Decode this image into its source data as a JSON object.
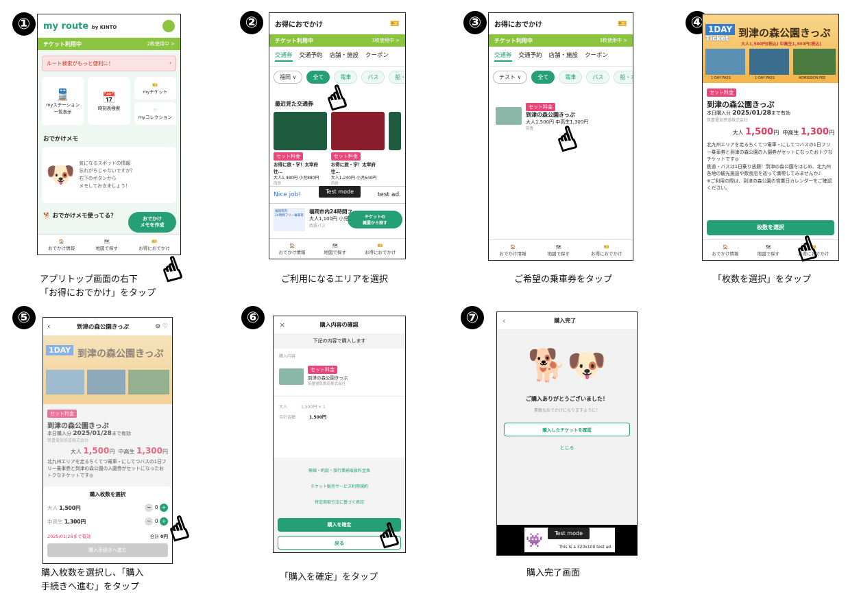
{
  "steps": [
    {
      "n": "①",
      "caption": "アプリトップ画面の右下\n「お得におでかけ」をタップ"
    },
    {
      "n": "②",
      "caption": "ご利用になるエリアを選択"
    },
    {
      "n": "③",
      "caption": "ご希望の乗車券をタップ"
    },
    {
      "n": "④",
      "caption": "「枚数を選択」をタップ"
    },
    {
      "n": "⑤",
      "caption": "購入枚数を選択し、「購入\n手続きへ進む」をタップ"
    },
    {
      "n": "⑥",
      "caption": "「購入を確定」をタップ"
    },
    {
      "n": "⑦",
      "caption": "購入完了画面"
    }
  ],
  "s1": {
    "logo": "my route",
    "logo_sub": "by KINTO",
    "ticket_bar": "チケット利用中",
    "ticket_count": "2枚使用中 >",
    "route_banner": "ルート検索がもっと便利に！",
    "my_station": "myステーション\n一覧表示",
    "timetable": "時刻表検索",
    "my_ticket": "myチケット",
    "my_collection": "myコレクション",
    "memo_title": "おでかけメモ",
    "memo_text": "気になるスポットの情報\n忘れがちじゃないですか？\n右下のボタンから\nメモしておきましょう！",
    "memo_q": "おでかけメモ使ってる？",
    "memo_btn": "おでかけ\nメモを作成",
    "nav": [
      "おでかけ情報",
      "地図で探す",
      "お得におでかけ"
    ]
  },
  "s2": {
    "title": "お得におでかけ",
    "ticket_bar": "チケット利用中",
    "ticket_count": "3枚使用中 >",
    "tabs": [
      "交通券",
      "交通予約",
      "店舗・施設",
      "クーポン"
    ],
    "area": "福岡",
    "chips": [
      "全て",
      "電車",
      "バス",
      "船・水上"
    ],
    "recent": "最近見た交通券",
    "cards": [
      {
        "tag": "セット料金",
        "name": "お得に旅・学！太宰府往…",
        "price": "大人1,480円 小児880円",
        "co": "西鉄"
      },
      {
        "tag": "セット料金",
        "name": "お得に旅・学！太宰府往…",
        "price": "大人1,240円 小児640円",
        "co": "西鉄"
      }
    ],
    "ad_left": "Nice job!",
    "ad_right": "test ad.",
    "test_mode": "Test mode",
    "ticket2_name": "福岡市内24時間フ",
    "ticket2_price": "大人1,100円 小児5",
    "ticket2_co": "西鉄バス",
    "ticket2_img": "福岡市内\n24時間フリー乗車券",
    "find_btn": "チケットの\n概要から探す",
    "nav": [
      "おでかけ情報",
      "地図で探す",
      "お得におでかけ"
    ]
  },
  "s3": {
    "title": "お得におでかけ",
    "ticket_bar": "チケット利用中",
    "ticket_count": "3枚使用中 >",
    "tabs": [
      "交通券",
      "交通予約",
      "店舗・施設",
      "クーポン"
    ],
    "area": "テスト",
    "chips": [
      "全て",
      "電車",
      "バス",
      "船・水上"
    ],
    "tag": "セット料金",
    "name": "到津の森公園きっぷ",
    "price": "大人1,500円 中高生1,300円",
    "co": "筑豊",
    "nav": [
      "おでかけ情報",
      "地図で探す",
      "お得におでかけ"
    ]
  },
  "s4": {
    "banner_day": "1DAY",
    "banner_ticket": "Ticket",
    "banner_title": "到津の森公園きっぷ",
    "banner_price": "大人1,500円(税込) 中高生1,300円(税込)",
    "photo_labels": [
      "1-DAY PASS",
      "1-DAY PASS",
      "ADMISSION FEE"
    ],
    "tag": "セット料金",
    "name": "到津の森公園きっぷ",
    "valid_pre": "本日購入分",
    "valid_date": "2025/01/28",
    "valid_post": "まで有効",
    "co": "筑豊電気鉄道株式会社",
    "adult_label": "大人",
    "adult_price": "1,500",
    "mid_label": "中高生",
    "mid_price": "1,300",
    "yen": "円",
    "desc": "北九州エリアを走るちくてつ電車・にしてつバスの1日フリー乗車券と到津の森公園の入園券がセットになったおトクなチケットです◎\n鉄道・バスは1日乗り放題！到津の森公園をはじめ、北九州各地の観光施設や飲食店を巡って満喫してみませんか♪\n※ご利用の際は、到津の森公園の営業日カレンダーをご確認ください。",
    "btn": "枚数を選択",
    "nav": [
      "おでかけ情報",
      "地図で探す",
      "お得におでかけ"
    ]
  },
  "s5": {
    "header": "到津の森公園きっぷ",
    "tag": "セット料金",
    "name": "到津の森公園きっぷ",
    "valid_pre": "本日購入分",
    "valid_date": "2025/01/28",
    "valid_post": "まで有効",
    "co": "筑豊電気鉄道株式会社",
    "adult_label": "大人",
    "adult_price": "1,500",
    "mid_label": "中高生",
    "mid_price": "1,300",
    "yen": "円",
    "desc": "北九州エリアを走るちくてつ電車・にしてつバスの1日フリー乗車券と到津の森公園の入園券がセットになったおトクなチケットです◎",
    "sheet_title": "購入枚数を選択",
    "row1_label": "大人",
    "row1_price": "1,500円",
    "row1_qty": "0",
    "row2_label": "中高生",
    "row2_price": "1,300円",
    "row2_qty": "0",
    "valid_until": "2025/01/28まで有効",
    "total_label": "合計",
    "total_val": "0円",
    "btn": "購入手続きへ進む"
  },
  "s6": {
    "header": "購入内容の確認",
    "intro": "下記の内容で購入します",
    "section": "購入内容",
    "tag": "セット料金",
    "name": "到津の森公園きっぷ",
    "co": "筑豊電気鉄道株式会社",
    "row1_k": "大人",
    "row1_v": "1,500円 × 1",
    "row2_k": "合計金額",
    "row2_v": "1,500円",
    "links": [
      "無線・約款・旅行業務取扱料金表",
      "チケット販売サービス利用規約",
      "特定商取引法に基づく表記"
    ],
    "confirm": "購入を確定",
    "back": "戻る"
  },
  "s7": {
    "header": "購入完了",
    "thanks": "ご購入ありがとうございました！",
    "sub": "素敵なおでかけになりますように！",
    "view_btn": "購入したチケットを確認",
    "close": "とじる",
    "test_mode": "Test mode",
    "ad": "This is a 320x100 test ad."
  }
}
